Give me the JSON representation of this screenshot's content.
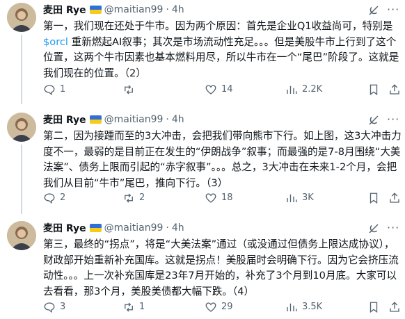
{
  "tweets": [
    {
      "author": "麦田 Rye",
      "handle": "@maitian99",
      "separator": "·",
      "time": "4h",
      "text_before": "第一，我们现在还处于牛市。因为两个原因：首先是企业Q1收益尚可，特别是",
      "cashtag": "$orcl",
      "text_after": " 重新燃起AI叙事；其次是市场流动性充足。。。但是美股牛市上行到了这个位置，这两个牛市因素也基本燃料用尽，所以牛市在一个“尾巴”阶段了。这就是我们现在的位置。（2）",
      "replies": "1",
      "retweets": "",
      "likes": "14",
      "views": "2.2K"
    },
    {
      "author": "麦田 Rye",
      "handle": "@maitian99",
      "separator": "·",
      "time": "4h",
      "text_before": "第二，因为接踵而至的3大冲击，会把我们带向熊市下行。如上图，这3大冲击力度不一，最弱的是目前正在发生的“伊朗战争”叙事；而最强的是7-8月围绕“大美法案”、债务上限而引起的“赤字叙事”。。。总之，3大冲击在未来1-2个月，会把我们从目前“牛市”尾巴，推向下行。（3）",
      "cashtag": "",
      "text_after": "",
      "replies": "2",
      "retweets": "2",
      "likes": "18",
      "views": "3K"
    },
    {
      "author": "麦田 Rye",
      "handle": "@maitian99",
      "separator": "·",
      "time": "4h",
      "text_before": "第三，最终的“拐点”，将是“大美法案”通过（或没通过但债务上限达成协议），财政部开始重新补充国库。这就是拐点！美股届时会明确下行。因为它会挤压流动性。。。上一次补充国库是23年7月开始的，补充了3个月到10月底。大家可以去看看，那3个月，美股美债都大幅下跌。（4）",
      "cashtag": "",
      "text_after": "",
      "replies": "3",
      "retweets": "1",
      "likes": "29",
      "views": "3.5K"
    }
  ],
  "colors": {
    "text": "#0f1419",
    "secondary": "#536471",
    "link": "#1d9bf0",
    "thread": "#cfd9de"
  },
  "icons": [
    "grok-icon",
    "more-icon",
    "reply-icon",
    "retweet-icon",
    "like-icon",
    "views-icon",
    "bookmark-icon",
    "share-icon"
  ]
}
